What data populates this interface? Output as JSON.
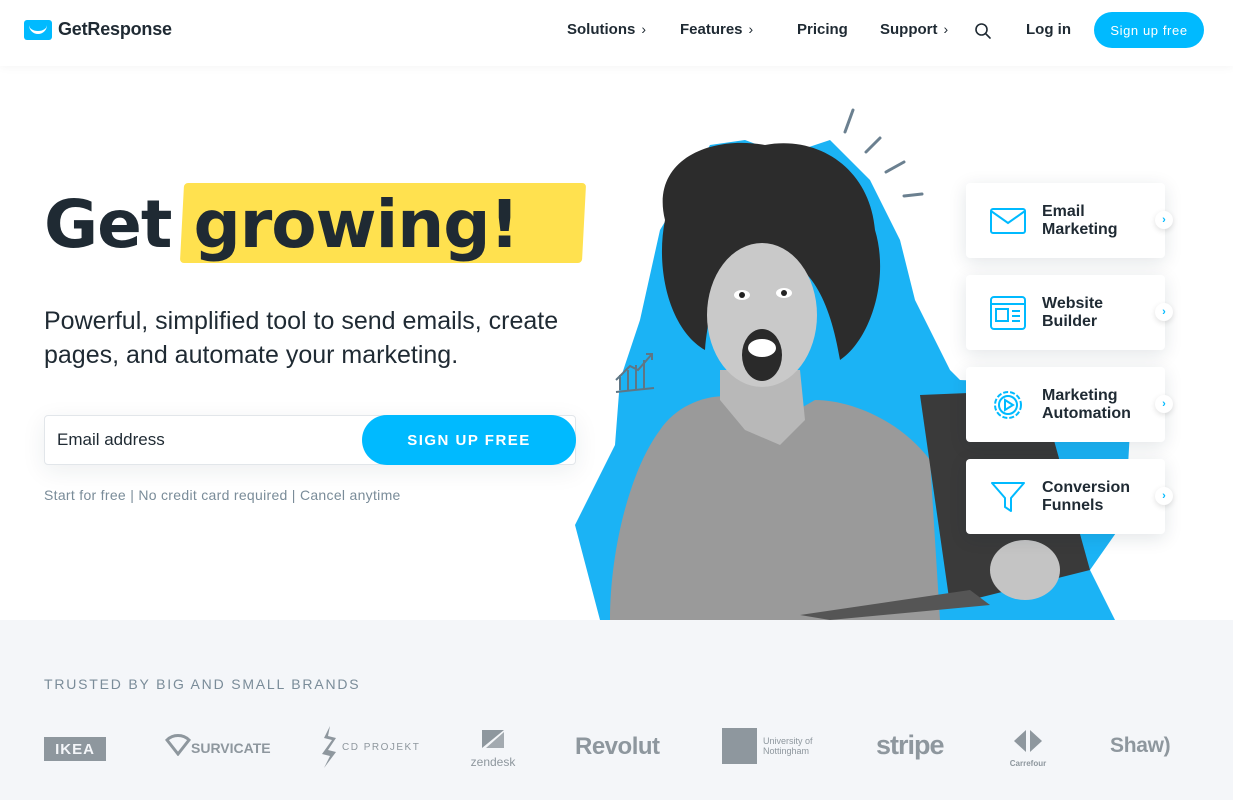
{
  "header": {
    "logo_text": "GetResponse",
    "nav": [
      {
        "label": "Solutions",
        "has_chevron": true
      },
      {
        "label": "Features",
        "has_chevron": true
      },
      {
        "label": "Pricing",
        "has_chevron": false
      },
      {
        "label": "Support",
        "has_chevron": true
      }
    ],
    "chevron": "›",
    "login_label": "Log in",
    "signup_label": "Sign up free"
  },
  "hero": {
    "headline_word1": "Get",
    "headline_word2": "growing!",
    "subheadline": "Powerful, simplified tool to send emails, create pages, and automate your marketing.",
    "email_placeholder": "Email address",
    "cta_label": "SIGN UP FREE",
    "note": "Start for free | No credit card required | Cancel anytime"
  },
  "feature_cards": [
    {
      "label": "Email Marketing",
      "icon": "envelope-icon"
    },
    {
      "label": "Website Builder",
      "icon": "website-icon"
    },
    {
      "label": "Marketing Automation",
      "icon": "gear-play-icon"
    },
    {
      "label": "Conversion Funnels",
      "icon": "funnel-icon"
    }
  ],
  "card_arrow": "›",
  "brands": {
    "heading": "TRUSTED BY BIG AND SMALL BRANDS",
    "logos": [
      {
        "name": "IKEA"
      },
      {
        "name": "SURVICATE"
      },
      {
        "name": "CD PROJEKT"
      },
      {
        "name": "zendesk"
      },
      {
        "name": "Revolut"
      },
      {
        "name": "University of Nottingham"
      },
      {
        "name": "stripe"
      },
      {
        "name": "Carrefour"
      },
      {
        "name": "Shaw)"
      }
    ]
  },
  "colors": {
    "accent": "#00baff",
    "highlight": "#ffe14f",
    "text": "#1f2a33",
    "muted": "#7a8c99",
    "brand_band": "#f4f6f9"
  }
}
